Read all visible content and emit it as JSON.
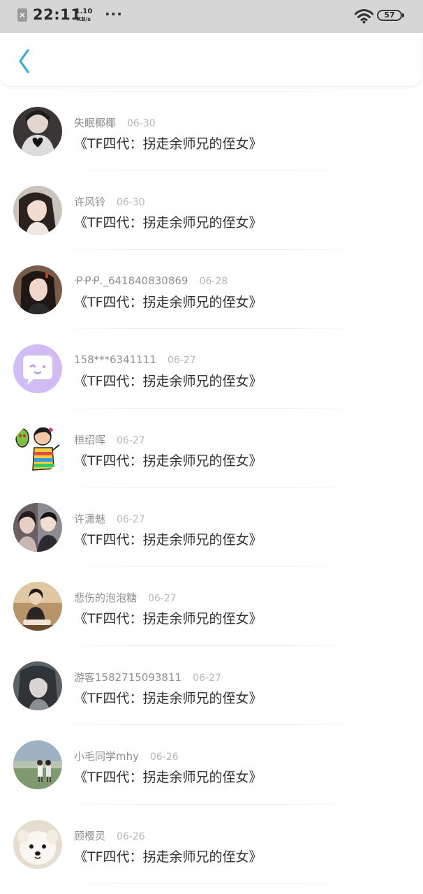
{
  "status_bar": {
    "time": "22:11",
    "net_speed_value": "1.10",
    "net_speed_unit": "KB/s",
    "dots": "···",
    "battery": "57"
  },
  "nav": {
    "back_icon": "chevron-left-icon",
    "accent_color": "#2fa8e3"
  },
  "items": [
    {
      "username": "失眠椰椰",
      "date": "06-30",
      "title": "《TF四代：拐走余师兄的侄女》"
    },
    {
      "username": "许风铃",
      "date": "06-30",
      "title": "《TF四代：拐走余师兄的侄女》"
    },
    {
      "username": "ᑶᑶᑶ._641840830869",
      "date": "06-28",
      "title": "《TF四代：拐走余师兄的侄女》"
    },
    {
      "username": "158***6341111",
      "date": "06-27",
      "title": "《TF四代：拐走余师兄的侄女》"
    },
    {
      "username": "桓绍晖",
      "date": "06-27",
      "title": "《TF四代：拐走余师兄的侄女》"
    },
    {
      "username": "许潇魅",
      "date": "06-27",
      "title": "《TF四代：拐走余师兄的侄女》"
    },
    {
      "username": "悲伤的泡泡糖",
      "date": "06-27",
      "title": "《TF四代：拐走余师兄的侄女》"
    },
    {
      "username": "游客1582715093811",
      "date": "06-27",
      "title": "《TF四代：拐走余师兄的侄女》"
    },
    {
      "username": "小毛同学mhy",
      "date": "06-26",
      "title": "《TF四代：拐走余师兄的侄女》"
    },
    {
      "username": "顾樱灵",
      "date": "06-26",
      "title": "《TF四代：拐走余师兄的侄女》"
    }
  ]
}
